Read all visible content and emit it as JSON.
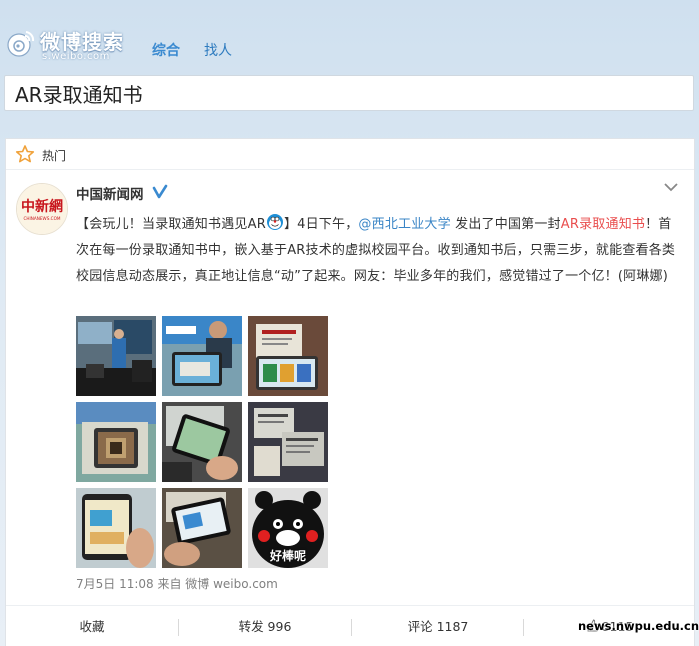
{
  "app": {
    "logo_title": "微博搜索",
    "logo_sub": "s.weibo.com",
    "tabs": [
      {
        "label": "综合",
        "active": true
      },
      {
        "label": "找人",
        "active": false
      }
    ]
  },
  "search": {
    "value": "AR录取通知书"
  },
  "section": {
    "label": "热门"
  },
  "post": {
    "author": "中国新闻网",
    "avatar_logo": "中新網",
    "avatar_sub": "CHINANEWS.COM",
    "text": {
      "p1": "【会玩儿！当录取通知书遇见AR",
      "p2": "】4日下午，",
      "mention": "@西北工业大学",
      "p3": " 发出了中国第一封",
      "topic": "AR录取通知书",
      "p4": "！首次在每一份录取通知书中，嵌入基于AR技术的虚拟校园平台。收到通知书后，只需三步，就能查看各类校园信息动态展示，真正地让信息“动”了起来。网友：毕业多年的我们，感觉错过了一个亿！(阿琳娜)"
    },
    "image_caption": "好棒呢",
    "meta": "7月5日 11:08 来自 微博 weibo.com",
    "actions": {
      "favorite": "收藏",
      "repost": "转发 996",
      "comment": "评论 1187",
      "like": "8115"
    }
  },
  "watermark": "news.nwpu.edu.cn",
  "colors": {
    "link": "#3a85c6",
    "topic": "#e94e4e",
    "weibo_orange": "#f0a23b"
  }
}
